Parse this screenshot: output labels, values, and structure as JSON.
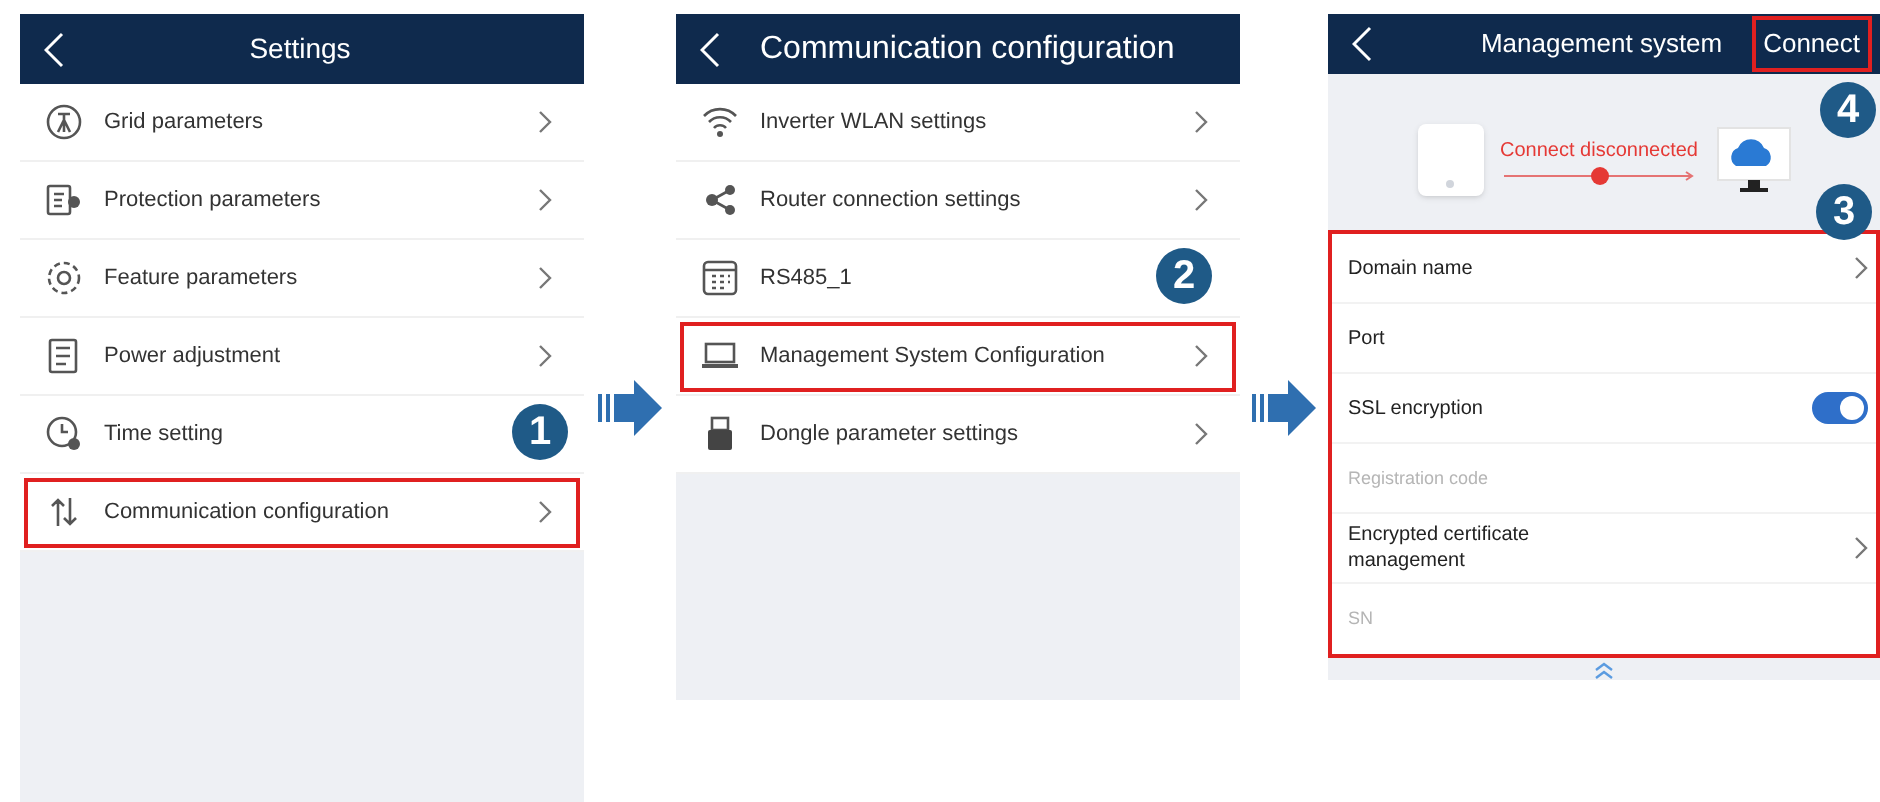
{
  "screens": [
    {
      "title": "Settings",
      "items": [
        {
          "label": "Grid parameters",
          "highlighted": false
        },
        {
          "label": "Protection parameters",
          "highlighted": false
        },
        {
          "label": "Feature parameters",
          "highlighted": false
        },
        {
          "label": "Power adjustment",
          "highlighted": false
        },
        {
          "label": "Time setting",
          "highlighted": false
        },
        {
          "label": "Communication configuration",
          "highlighted": true
        }
      ],
      "step": {
        "number": "1"
      }
    },
    {
      "title": "Communication configuration",
      "items": [
        {
          "label": "Inverter WLAN settings",
          "highlighted": false
        },
        {
          "label": "Router connection settings",
          "highlighted": false
        },
        {
          "label": "RS485_1",
          "highlighted": false
        },
        {
          "label": "Management System Configuration",
          "highlighted": true
        },
        {
          "label": "Dongle parameter settings",
          "highlighted": false
        }
      ],
      "step": {
        "number": "2"
      }
    },
    {
      "title": "Management system",
      "action": {
        "label": "Connect",
        "highlighted": true
      },
      "action_step": "4",
      "status": "Connect disconnected",
      "list_step": "3",
      "list_highlighted": true,
      "fields": [
        {
          "label": "Domain name",
          "kind": "link",
          "disabled": false
        },
        {
          "label": "Port",
          "kind": "plain",
          "disabled": false
        },
        {
          "label": "SSL encryption",
          "kind": "toggle",
          "disabled": false,
          "on": true
        },
        {
          "label": "Registration code",
          "kind": "plain",
          "disabled": true
        },
        {
          "label": "Encrypted certificate management",
          "kind": "link",
          "disabled": false
        },
        {
          "label": "SN",
          "kind": "plain",
          "disabled": true
        }
      ]
    }
  ]
}
